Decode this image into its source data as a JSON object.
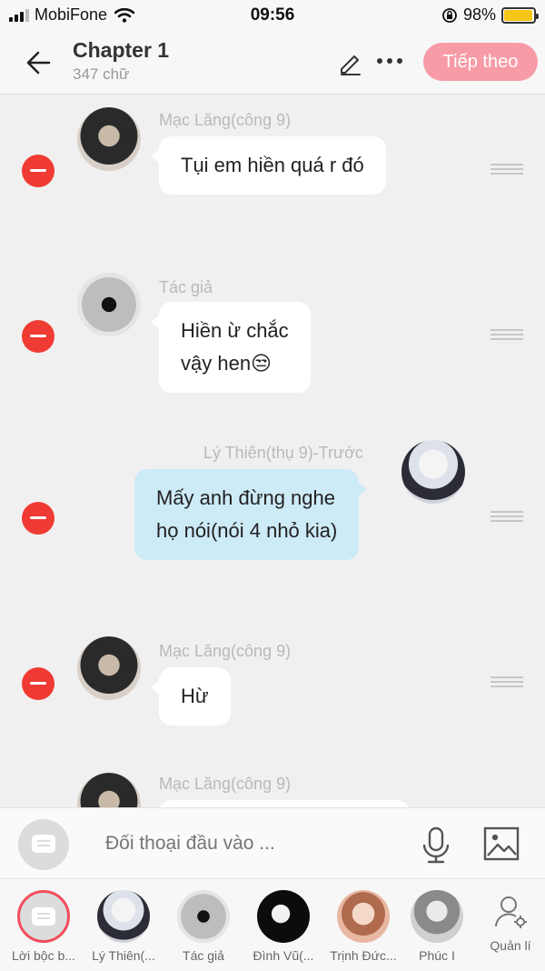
{
  "status_bar": {
    "carrier": "MobiFone",
    "time": "09:56",
    "battery": "98%",
    "battery_level": 0.98
  },
  "header": {
    "title": "Chapter 1",
    "subtitle": "347 chữ",
    "next_label": "Tiếp theo"
  },
  "messages": [
    {
      "name": "Mạc Lăng(công 9)",
      "lines": [
        "Tụi em hiền quá r đó"
      ],
      "side": "left"
    },
    {
      "name": "Tác giả",
      "lines": [
        "Hiền ừ chắc",
        "vậy hen😒"
      ],
      "side": "left"
    },
    {
      "name": "Lý Thiên(thụ 9)-Trước",
      "lines": [
        "Mấy anh đừng nghe",
        "họ nói(nói 4 nhỏ kia)"
      ],
      "side": "right"
    },
    {
      "name": "Mạc Lăng(công 9)",
      "lines": [
        "Hừ"
      ],
      "side": "left"
    },
    {
      "name": "Mạc Lăng(công 9)",
      "lines": [
        ""
      ],
      "side": "left"
    }
  ],
  "input": {
    "placeholder": "Đối thoại đầu vào ..."
  },
  "characters": [
    {
      "label": "Lời bộc b..."
    },
    {
      "label": "Lý Thiên(..."
    },
    {
      "label": "Tác giả"
    },
    {
      "label": "Đình Vũ(..."
    },
    {
      "label": "Trịnh Đức..."
    },
    {
      "label": "Phúc I"
    }
  ],
  "manage": {
    "label": "Quản lí"
  },
  "icons": {
    "back": "arrow-left-icon",
    "edit": "pencil-icon",
    "more": "more-icon",
    "mic": "microphone-icon",
    "image": "image-icon",
    "chat": "chat-icon",
    "manage": "user-gear-icon"
  },
  "colors": {
    "accent": "#f79ba6",
    "delete": "#ef3b33",
    "bubble_right": "#cdeaf7",
    "active_ring": "#f24d5a"
  }
}
